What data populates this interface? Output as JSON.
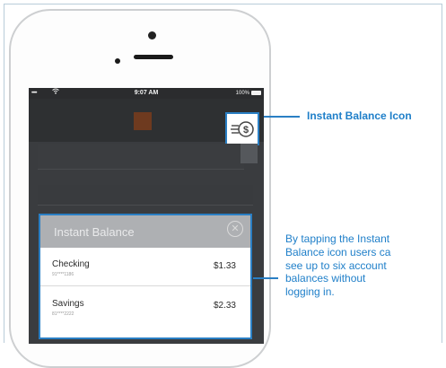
{
  "status_bar": {
    "time": "9:07 AM",
    "battery": "100%",
    "signal": "•••••",
    "wifi_icon": "wifi-icon"
  },
  "app_header": {
    "logo_icon": "bank-logo",
    "instant_balance_icon": "instant-balance-icon"
  },
  "instant_balance": {
    "title": "Instant Balance",
    "close_icon": "close-icon",
    "accounts": [
      {
        "name": "Checking",
        "number": "91****1186",
        "balance": "$1.33"
      },
      {
        "name": "Savings",
        "number": "81****2222",
        "balance": "$2.33"
      }
    ]
  },
  "annotations": {
    "icon_label": "Instant Balance Icon",
    "description": "By tapping the Instant\nBalance icon users ca\nsee up to six account\nbalances without\nlogging in."
  },
  "colors": {
    "accent_blue": "#2a7fc4",
    "callout_text": "#1f7fc9",
    "screen_bg": "#3a3c3f",
    "panel_header": "#aeb0b3",
    "logo": "#6e3a1f"
  }
}
